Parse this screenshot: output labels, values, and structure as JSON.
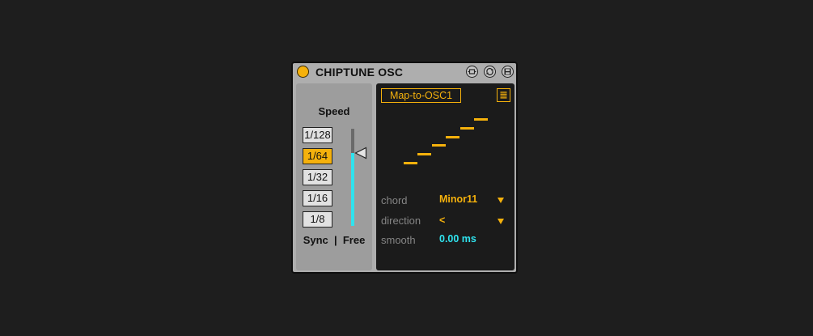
{
  "device": {
    "title": "CHIPTUNE OSC",
    "icons": [
      "power-icon",
      "map-icon",
      "hot-swap-icon",
      "save-icon"
    ]
  },
  "speed": {
    "label": "Speed",
    "rates": [
      "1/128",
      "1/64",
      "1/32",
      "1/16",
      "1/8"
    ],
    "selected": "1/64",
    "slider_level": 0.75,
    "mode_label": "Sync  |  Free"
  },
  "mapping": {
    "map_button": "Map-to-OSC1",
    "menu_icon": "list-menu-icon"
  },
  "arpeggio_steps": [
    1,
    2,
    3,
    4,
    5,
    6
  ],
  "params": {
    "chord": {
      "label": "chord",
      "value": "Minor11"
    },
    "direction": {
      "label": "direction",
      "value": "<"
    },
    "smooth": {
      "label": "smooth",
      "value": "0.00 ms"
    }
  },
  "colors": {
    "accent": "#f5b10c",
    "cyan": "#2fe3ee",
    "panel": "#aeaeae",
    "dark_panel": "#1b1b1b",
    "background": "#1e1e1e"
  }
}
